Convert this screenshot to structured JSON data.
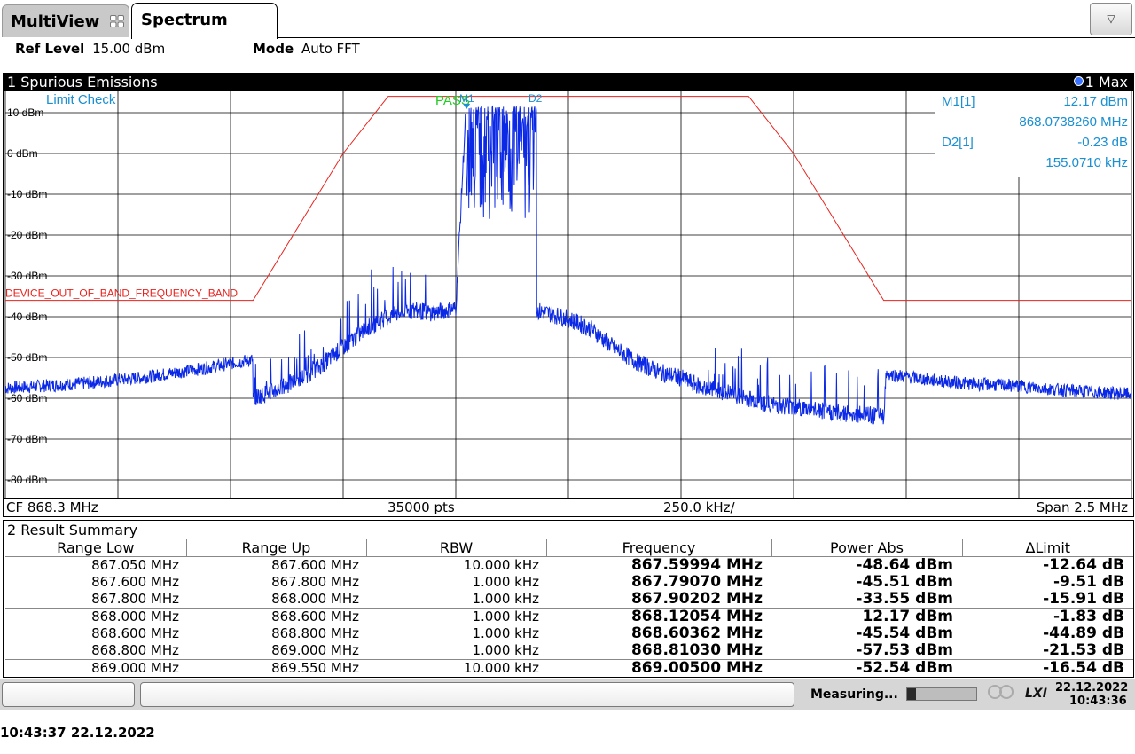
{
  "tabs": {
    "multiview": "MultiView",
    "spectrum": "Spectrum",
    "dropdown_icon": "triangle-down-icon"
  },
  "settings": {
    "ref_level_label": "Ref Level",
    "ref_level_value": "15.00 dBm",
    "mode_label": "Mode",
    "mode_value": "Auto FFT"
  },
  "diagram": {
    "title": "1 Spurious Emissions",
    "trace_label": "1 Max",
    "limit_check_label": "Limit Check",
    "pass_label": "PASS",
    "limit_line_name": "DEVICE_OUT_OF_BAND_FREQUENCY_BAND",
    "marker_labels": [
      "M1",
      "D2"
    ],
    "footer": {
      "cf": "CF 868.3 MHz",
      "points": "35000 pts",
      "div": "250.0 kHz/",
      "span": "Span 2.5 MHz"
    },
    "marker_info": [
      {
        "name": "M1[1]",
        "value": "12.17 dBm"
      },
      {
        "name": "",
        "value": "868.0738260 MHz"
      },
      {
        "name": "D2[1]",
        "value": "-0.23 dB"
      },
      {
        "name": "",
        "value": "155.0710 kHz"
      }
    ],
    "colors": {
      "trace": "#0a28e6",
      "limit": "#e8231e",
      "pass": "#22cc22",
      "marker_text": "#1a8fd1"
    }
  },
  "chart_data": {
    "type": "line",
    "title": "1 Spurious Emissions",
    "xlabel": "",
    "ylabel": "",
    "x_unit": "MHz",
    "xlim": [
      867.05,
      869.55
    ],
    "ylim": [
      -85,
      15
    ],
    "yticks": [
      10,
      0,
      -10,
      -20,
      -30,
      -40,
      -50,
      -60,
      -70,
      -80
    ],
    "ytick_labels": [
      "10 dBm",
      "0 dBm",
      "-10 dBm",
      "-20 dBm",
      "-30 dBm",
      "-40 dBm",
      "-50 dBm",
      "-60 dBm",
      "-70 dBm",
      "-80 dBm"
    ],
    "grid": true,
    "series": [
      {
        "name": "1 Max",
        "x": [
          867.05,
          867.2,
          867.35,
          867.5,
          867.599,
          867.6,
          867.65,
          867.7,
          867.75,
          867.8,
          867.85,
          867.9,
          867.95,
          868.0,
          868.05,
          868.073,
          868.1,
          868.15,
          868.2,
          868.25,
          868.3,
          868.35,
          868.4,
          868.45,
          868.5,
          868.55,
          868.6,
          868.65,
          868.7,
          868.75,
          868.8,
          868.85,
          868.9,
          868.95,
          869.0,
          869.005,
          869.1,
          869.2,
          869.3,
          869.4,
          869.55
        ],
        "y": [
          -57.5,
          -56.5,
          -55,
          -52.5,
          -50.5,
          -60,
          -58,
          -55.5,
          -52,
          -47.5,
          -43,
          -40,
          -38.5,
          -39,
          -38,
          12.2,
          11,
          11.5,
          -38,
          -39,
          -40.5,
          -43,
          -47.5,
          -51,
          -53.5,
          -55,
          -57.5,
          -58.5,
          -60,
          -61.5,
          -62,
          -63,
          -63.5,
          -64,
          -64.5,
          -54,
          -55.5,
          -56.5,
          -57,
          -58,
          -59
        ]
      }
    ],
    "limit_line": {
      "name": "DEVICE_OUT_OF_BAND_FREQUENCY_BAND",
      "x": [
        867.05,
        867.6,
        867.8,
        867.9,
        868.7,
        868.8,
        869.0,
        869.55
      ],
      "y": [
        -36,
        -36,
        0,
        14,
        14,
        0,
        -36,
        -36
      ]
    },
    "markers": [
      {
        "name": "M1",
        "x": 868.073826,
        "y": 12.17
      },
      {
        "name": "D2",
        "x": 868.2289,
        "y": 11.94
      }
    ]
  },
  "result_summary": {
    "title": "2 Result Summary",
    "columns": [
      "Range Low",
      "Range Up",
      "RBW",
      "Frequency",
      "Power Abs",
      "ΔLimit"
    ],
    "rows": [
      [
        "867.050 MHz",
        "867.600 MHz",
        "10.000 kHz",
        "867.59994 MHz",
        "-48.64 dBm",
        "-12.64 dB"
      ],
      [
        "867.600 MHz",
        "867.800 MHz",
        "1.000 kHz",
        "867.79070 MHz",
        "-45.51 dBm",
        "-9.51 dB"
      ],
      [
        "867.800 MHz",
        "868.000 MHz",
        "1.000 kHz",
        "867.90202 MHz",
        "-33.55 dBm",
        "-15.91 dB"
      ],
      [
        "868.000 MHz",
        "868.600 MHz",
        "1.000 kHz",
        "868.12054 MHz",
        "12.17 dBm",
        "-1.83 dB"
      ],
      [
        "868.600 MHz",
        "868.800 MHz",
        "1.000 kHz",
        "868.60362 MHz",
        "-45.54 dBm",
        "-44.89 dB"
      ],
      [
        "868.800 MHz",
        "869.000 MHz",
        "1.000 kHz",
        "868.81030 MHz",
        "-57.53 dBm",
        "-21.53 dB"
      ],
      [
        "869.000 MHz",
        "869.550 MHz",
        "10.000 kHz",
        "869.00500 MHz",
        "-52.54 dBm",
        "-16.54 dB"
      ]
    ]
  },
  "status_bar": {
    "measuring": "Measuring...",
    "lxi": "LXI",
    "ref_icon": "ref-icon",
    "date": "22.12.2022",
    "time": "10:43:36"
  },
  "footer_timestamp": "10:43:37  22.12.2022"
}
